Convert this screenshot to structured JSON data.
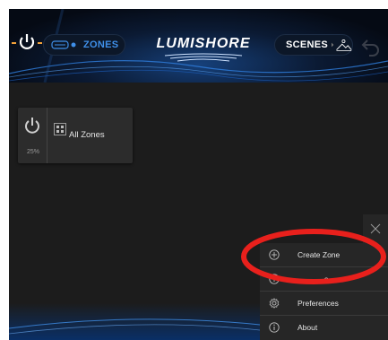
{
  "header": {
    "zones_label": "ZONES",
    "logo_text": "LUMISHORE",
    "scenes_label": "SCENES"
  },
  "zone_card": {
    "name": "All Zones",
    "level_text": "25%"
  },
  "menu": {
    "items": [
      {
        "label": "Create Zone",
        "icon": "plus-circle-icon"
      },
      {
        "label": "",
        "visible_fragment": "s",
        "icon": "plus-circle-icon"
      },
      {
        "label": "Preferences",
        "icon": "gear-icon"
      },
      {
        "label": "About",
        "icon": "info-icon"
      }
    ]
  },
  "colors": {
    "accent_orange": "#f2a23a",
    "accent_blue": "#3f8fe8",
    "annotation_red": "#e8201c"
  }
}
